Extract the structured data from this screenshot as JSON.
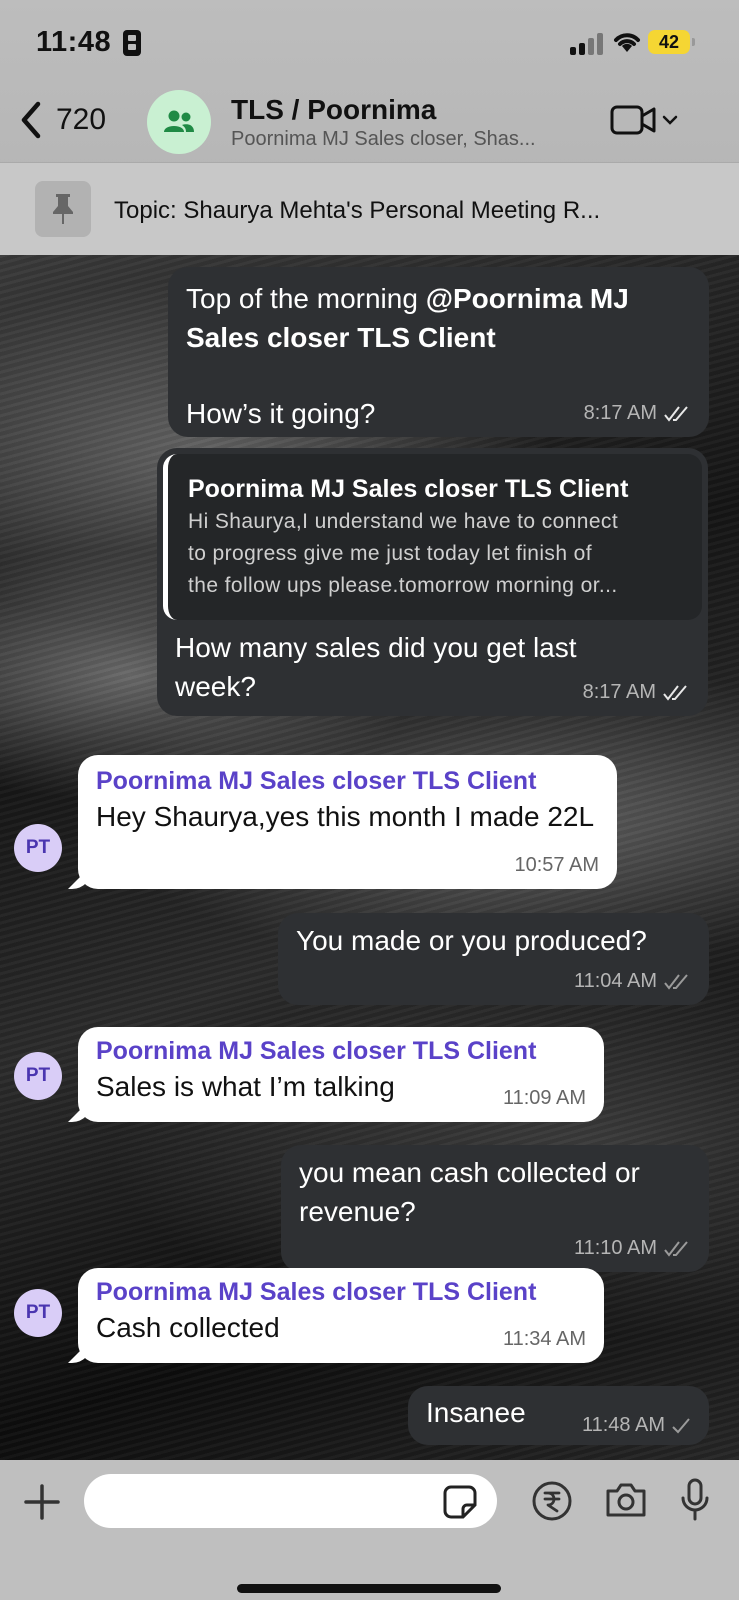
{
  "status_bar": {
    "time": "11:48",
    "battery": "42"
  },
  "header": {
    "back_count": "720",
    "title": "TLS / Poornima",
    "subtitle": "Poornima MJ Sales closer, Shas..."
  },
  "pinned": {
    "text": "Topic: Shaurya Mehta's Personal Meeting R..."
  },
  "messages": [
    {
      "direction": "out",
      "text_plain": "Top of the morning ",
      "mention": "@Poornima MJ Sales closer TLS Client",
      "line2": "How’s it going?",
      "time": "8:17 AM"
    },
    {
      "direction": "out",
      "quote_author": "Poornima MJ Sales closer TLS Client",
      "quote_line1": "Hi Shaurya,I understand we have to connect",
      "quote_line2": "to progress give me just today let finish of",
      "quote_line3": "the follow ups please.tomorrow morning or...",
      "text": "How many sales did you get last week?",
      "time": "8:17 AM"
    },
    {
      "direction": "in",
      "sender": "Poornima MJ Sales closer TLS Client",
      "avatar": "PT",
      "text": "Hey Shaurya,yes this month I made 22L",
      "time": "10:57 AM"
    },
    {
      "direction": "out",
      "text": "You made or you produced?",
      "time": "11:04 AM"
    },
    {
      "direction": "in",
      "sender": "Poornima MJ Sales closer TLS Client",
      "avatar": "PT",
      "text": "Sales is what I’m talking",
      "time": "11:09 AM"
    },
    {
      "direction": "out",
      "text": "you mean cash collected or revenue?",
      "time": "11:10 AM"
    },
    {
      "direction": "in",
      "sender": "Poornima MJ Sales closer TLS Client",
      "avatar": "PT",
      "text": "Cash collected",
      "time": "11:34 AM"
    },
    {
      "direction": "out",
      "text": "Insanee",
      "time": "11:48 AM"
    }
  ],
  "composer": {
    "placeholder": ""
  },
  "icons": {
    "back": "chevron-left-icon",
    "group": "group-icon",
    "video": "video-camera-icon",
    "pin": "pin-icon",
    "plus": "plus-icon",
    "sticker": "sticker-icon",
    "rupee": "rupee-payment-icon",
    "camera": "camera-icon",
    "mic": "microphone-icon",
    "read": "double-check-icon",
    "sent": "single-check-icon"
  },
  "colors": {
    "outgoing_bubble": "#2e3033",
    "incoming_bubble": "#ffffff",
    "sender_name": "#5a42c8",
    "avatar_bg": "#d9cdf7",
    "group_avatar_bg": "#c9f0d2",
    "battery": "#f5d633"
  }
}
